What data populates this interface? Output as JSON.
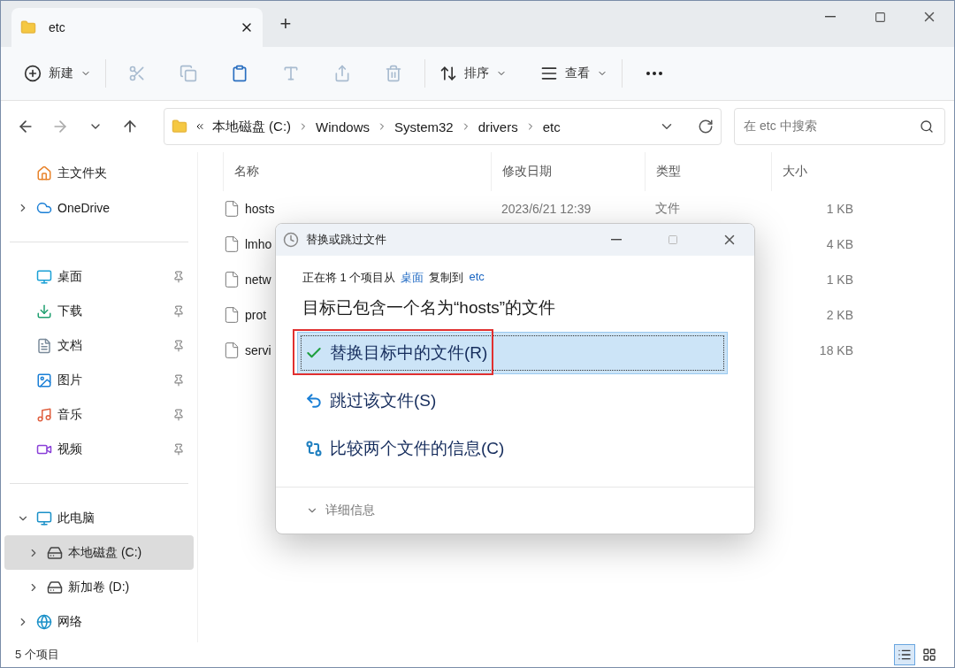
{
  "tabs": [
    {
      "label": "etc",
      "selected": true
    }
  ],
  "new_tab": "+",
  "toolbar": {
    "new_label": "新建",
    "actions": [
      {
        "kind": "cut",
        "disabled": true
      },
      {
        "kind": "copy",
        "disabled": true
      },
      {
        "kind": "paste",
        "disabled": false
      },
      {
        "kind": "rename",
        "disabled": true
      },
      {
        "kind": "share",
        "disabled": true
      },
      {
        "kind": "delete",
        "disabled": true
      }
    ],
    "sort_label": "排序",
    "view_label": "查看"
  },
  "address": {
    "crumbs": [
      "本地磁盘 (C:)",
      "Windows",
      "System32",
      "drivers",
      "etc"
    ],
    "search_placeholder": "在 etc 中搜索"
  },
  "sidebar": {
    "groups": [
      [
        {
          "label": "主文件夹",
          "kind": "home",
          "pinned": false,
          "expandable": false,
          "selected": false
        },
        {
          "label": "OneDrive",
          "kind": "cloud",
          "pinned": false,
          "expandable": true,
          "selected": false
        }
      ],
      [
        {
          "label": "桌面",
          "kind": "desktop",
          "pinned": true,
          "expandable": false,
          "selected": false
        },
        {
          "label": "下载",
          "kind": "download",
          "pinned": true,
          "expandable": false,
          "selected": false
        },
        {
          "label": "文档",
          "kind": "document",
          "pinned": true,
          "expandable": false,
          "selected": false
        },
        {
          "label": "图片",
          "kind": "picture",
          "pinned": true,
          "expandable": false,
          "selected": false
        },
        {
          "label": "音乐",
          "kind": "music",
          "pinned": true,
          "expandable": false,
          "selected": false
        },
        {
          "label": "视频",
          "kind": "video",
          "pinned": true,
          "expandable": false,
          "selected": false
        }
      ],
      [
        {
          "label": "此电脑",
          "kind": "computer",
          "pinned": false,
          "expandable": true,
          "expanded": true,
          "selected": false,
          "children": [
            {
              "label": "本地磁盘 (C:)",
              "kind": "drive",
              "pinned": false,
              "expandable": true,
              "selected": true
            },
            {
              "label": "新加卷 (D:)",
              "kind": "drive",
              "pinned": false,
              "expandable": true,
              "selected": false
            }
          ]
        },
        {
          "label": "网络",
          "kind": "network",
          "pinned": false,
          "expandable": true,
          "selected": false
        }
      ]
    ]
  },
  "table": {
    "columns": [
      "名称",
      "修改日期",
      "类型",
      "大小"
    ],
    "rows": [
      {
        "name": "hosts",
        "modified": "2023/6/21 12:39",
        "type": "文件",
        "size": "1 KB"
      },
      {
        "name": "lmho",
        "size": "4 KB"
      },
      {
        "name": "netw",
        "size": "1 KB"
      },
      {
        "name": "prot",
        "size": "2 KB"
      },
      {
        "name": "servi",
        "size": "18 KB"
      }
    ]
  },
  "status_bar": {
    "count": "5 个项目",
    "views": [
      {
        "kind": "details",
        "selected": true
      },
      {
        "kind": "tiles",
        "selected": false
      }
    ]
  },
  "dialog": {
    "title": "替换或跳过文件",
    "parts": [
      {
        "kind": "text",
        "text": "正在将 1 个项目从"
      },
      {
        "kind": "link",
        "text": "桌面"
      },
      {
        "kind": "text",
        "text": "复制到"
      },
      {
        "kind": "link",
        "text": "etc"
      }
    ],
    "heading": "目标已包含一个名为“hosts”的文件",
    "options": [
      {
        "kind": "replace",
        "label": "替换目标中的文件(R)",
        "selected": true,
        "highlighted": true
      },
      {
        "kind": "skip",
        "label": "跳过该文件(S)",
        "selected": false,
        "highlighted": false
      },
      {
        "kind": "compare",
        "label": "比较两个文件的信息(C)",
        "selected": false,
        "highlighted": false
      }
    ],
    "details": "详细信息"
  }
}
